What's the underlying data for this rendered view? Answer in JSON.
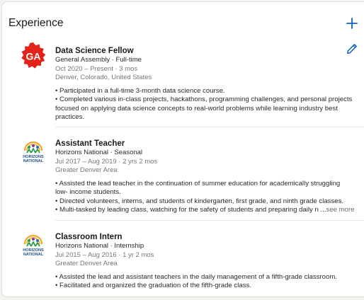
{
  "section": {
    "title": "Experience"
  },
  "colors": {
    "accent": "#0a66c2",
    "ga_red": "#e2231a"
  },
  "entries": [
    {
      "logo_icon": "general-assembly-logo",
      "title": "Data Science Fellow",
      "company": "General Assembly · Full-time",
      "dates": "Oct 2020 – Present · 3 mos",
      "location": "Denver, Colorado, United States",
      "desc": [
        "• Participated in a full-time 3-month data science course.",
        "• Completed various in-class projects, hackathons, programming challenges, and personal projects",
        "focused on applying data science concepts to real-world problems while learning industry best",
        "practices."
      ]
    },
    {
      "logo_icon": "horizons-national-logo",
      "logo_text": [
        "HORIZONS",
        "NATIONAL"
      ],
      "title": "Assistant Teacher",
      "company": "Horizons National · Seasonal",
      "dates": "Jul 2017 – Aug 2019 · 2 yrs 2 mos",
      "location": "Greater Denver Area",
      "desc": [
        "• Assisted the lead teacher in the continuation of summer education for academically struggling",
        "low- income students.",
        "• Directed volunteers, interns, and students of kindergarten, first grade, and ninth grade classes.",
        "• Multi-tasked by leading class, watching for the safety of students and preparing daily n ..."
      ],
      "see_more": "see more"
    },
    {
      "logo_icon": "horizons-national-logo",
      "logo_text": [
        "HORIZONS",
        "NATIONAL"
      ],
      "title": "Classroom Intern",
      "company": "Horizons National · Internship",
      "dates": "Jul 2015 – Aug 2016 · 1 yr 2 mos",
      "location": "Greater Denver Area",
      "desc": [
        "• Assisted the lead and assistant teachers in the daily management of a fifth-grade classroom.",
        "• Facilitated and organized the graduation of the fifth-grade class."
      ]
    }
  ]
}
